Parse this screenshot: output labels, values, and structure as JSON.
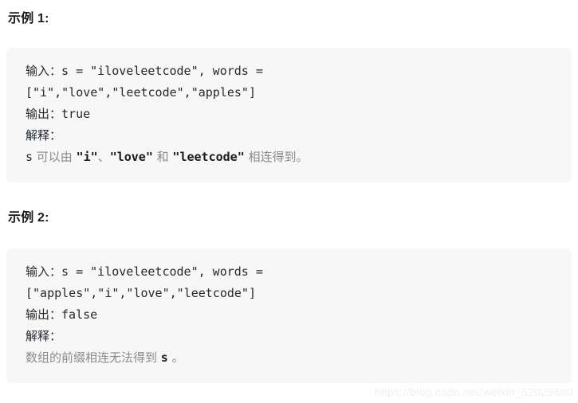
{
  "page": {
    "background": "#ffffff",
    "code_block_background": "#f7f7f7",
    "text_color": "#24292e",
    "muted_text_color": "#8a8a8a",
    "watermark_color": "#f0f0f0"
  },
  "examples": [
    {
      "heading": "示例 1:",
      "input_label": "输入：",
      "input_value_line1": "s = \"iloveleetcode\", words =",
      "input_value_line2": "[\"i\",\"love\",\"leetcode\",\"apples\"]",
      "output_label": "输出：",
      "output_value": "true",
      "explanation_label": "解释：",
      "explanation_parts": {
        "p1": "s",
        "p2": " 可以由 ",
        "p3": "\"i\"",
        "p4": "、",
        "p5": "\"love\"",
        "p6": " 和 ",
        "p7": "\"leetcode\"",
        "p8": " 相连得到。"
      }
    },
    {
      "heading": "示例 2:",
      "input_label": "输入：",
      "input_value_line1": "s = \"iloveleetcode\", words =",
      "input_value_line2": "[\"apples\",\"i\",\"love\",\"leetcode\"]",
      "output_label": "输出：",
      "output_value": "false",
      "explanation_label": "解释：",
      "explanation_parts": {
        "p1": "数组的前缀相连无法得到 ",
        "p2": "s",
        "p3": " 。"
      }
    }
  ],
  "watermark": {
    "text": "https://blog.csdn.net/weixin_52029600"
  }
}
